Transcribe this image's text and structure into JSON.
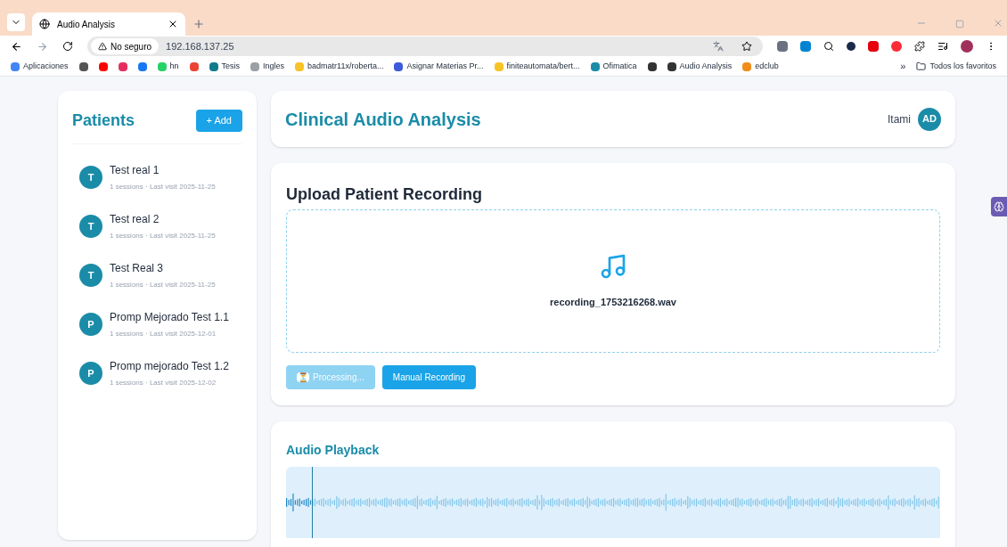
{
  "browser": {
    "tab": {
      "title": "Audio Analysis"
    },
    "security": "No seguro",
    "url": "192.168.137.25",
    "bookmarks": [
      {
        "label": "Aplicaciones",
        "color": "#4285f4"
      },
      {
        "color": "#555555"
      },
      {
        "color": "#ff0000"
      },
      {
        "color": "#e62e5c"
      },
      {
        "color": "#1877f2"
      },
      {
        "label": "hn",
        "color": "#25d366"
      },
      {
        "color": "#ea4335"
      },
      {
        "label": "Tesis",
        "color": "#0f7b8a"
      },
      {
        "label": "Ingles",
        "color": "#9aa0a6"
      },
      {
        "label": "badmatr11x/roberta...",
        "color": "#f7c325"
      },
      {
        "label": "Asignar Materias Pr...",
        "color": "#3b5bdb"
      },
      {
        "label": "finiteautomata/bert...",
        "color": "#f7c325"
      },
      {
        "label": "Ofimatica",
        "color": "#1a8ca8"
      },
      {
        "color": "#333333"
      },
      {
        "label": "Audio Analysis",
        "color": "#333333"
      },
      {
        "label": "edclub",
        "color": "#f08c1a"
      }
    ],
    "more": "»",
    "all_bookmarks": "Todos los favoritos"
  },
  "sidebar": {
    "title": "Patients",
    "add_button": "+ Add",
    "patients": [
      {
        "initial": "T",
        "name": "Test real 1",
        "meta": "1 sessions · Last visit 2025-11-25"
      },
      {
        "initial": "T",
        "name": "Test real 2",
        "meta": "1 sessions · Last visit 2025-11-25"
      },
      {
        "initial": "T",
        "name": "Test Real 3",
        "meta": "1 sessions · Last visit 2025-11-25"
      },
      {
        "initial": "P",
        "name": "Promp Mejorado Test 1.1",
        "meta": "1 sessions · Last visit 2025-12-01"
      },
      {
        "initial": "P",
        "name": "Promp mejorado Test 1.2",
        "meta": "1 sessions · Last visit 2025-12-02"
      }
    ]
  },
  "header": {
    "title": "Clinical Audio Analysis",
    "user": "Itami",
    "avatar": "AD"
  },
  "upload": {
    "title": "Upload Patient Recording",
    "file": "recording_1753216268.wav",
    "buttons": [
      {
        "label": "Processing...",
        "icon": "⏳",
        "disabled": true
      },
      {
        "label": "Manual Recording",
        "disabled": false
      }
    ]
  },
  "playback": {
    "title": "Audio Playback",
    "level": 0.04
  }
}
